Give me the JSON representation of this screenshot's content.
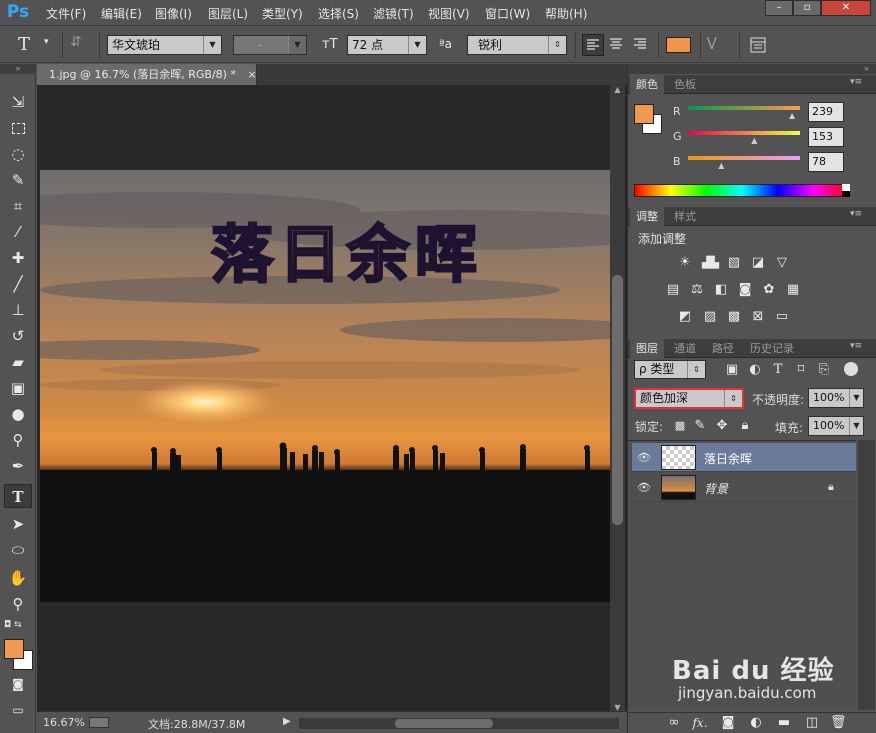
{
  "app": {
    "logo": "Ps"
  },
  "menu": [
    "文件(F)",
    "编辑(E)",
    "图像(I)",
    "图层(L)",
    "类型(Y)",
    "选择(S)",
    "滤镜(T)",
    "视图(V)",
    "窗口(W)",
    "帮助(H)"
  ],
  "window_controls": [
    "–",
    "▫",
    "✕"
  ],
  "options": {
    "tool_icon": "T",
    "font_family": "华文琥珀",
    "font_style": "-",
    "size": "72 点",
    "aa_label": "ªa",
    "antialias": "锐利",
    "color": "#f0954e"
  },
  "document": {
    "tab": "1.jpg @ 16.7% (落日余晖, RGB/8) *",
    "close": "×",
    "text_layer": "落日余晖"
  },
  "status": {
    "zoom": "16.67%",
    "doc_info": "文档:28.8M/37.8M"
  },
  "color_panel": {
    "tabs": [
      "颜色",
      "色板"
    ],
    "fg": "#ef994e",
    "r_label": "R",
    "g_label": "G",
    "b_label": "B",
    "r": "239",
    "g": "153",
    "b": "78",
    "r_frac": 0.937,
    "g_frac": 0.6,
    "b_frac": 0.306
  },
  "adjust_panel": {
    "tabs": [
      "调整",
      "样式"
    ],
    "heading": "添加调整"
  },
  "layers_panel": {
    "tabs": [
      "图层",
      "通道",
      "路径",
      "历史记录"
    ],
    "filter": "ρ 类型",
    "blend_mode": "颜色加深",
    "opacity_label": "不透明度:",
    "opacity": "100%",
    "lock_label": "锁定:",
    "fill_label": "填充:",
    "fill": "100%",
    "layers": [
      {
        "name": "落日余晖",
        "selected": true
      },
      {
        "name": "背景",
        "locked": true
      }
    ]
  },
  "watermark": {
    "brand": "Bai du 经验",
    "url": "jingyan.baidu.com"
  }
}
